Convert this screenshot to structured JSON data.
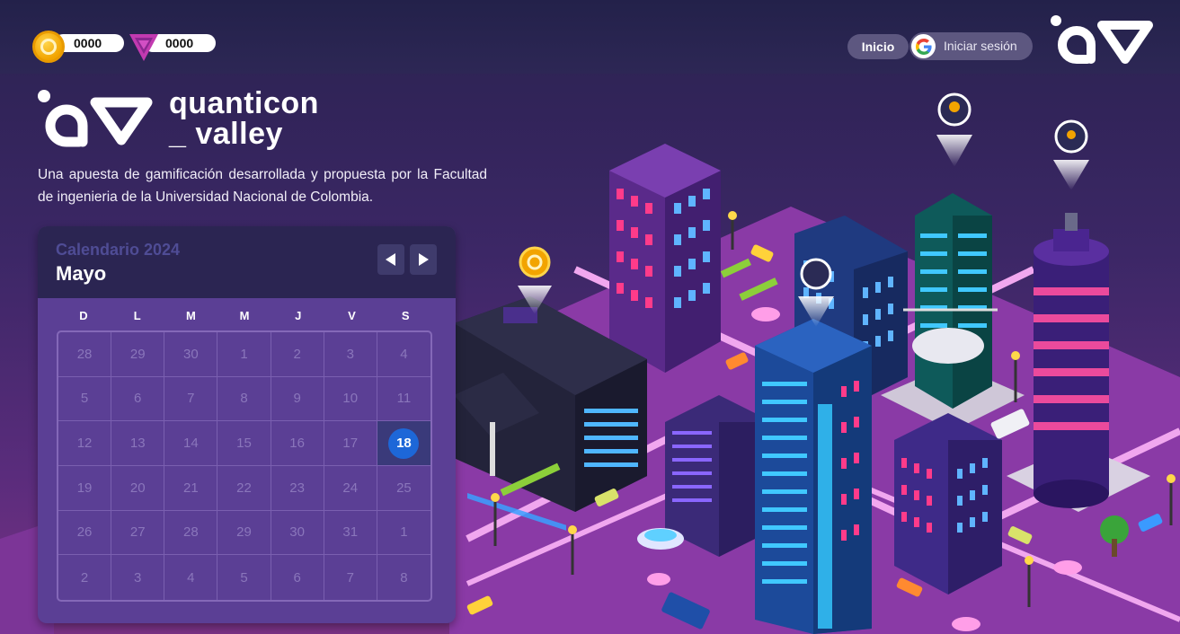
{
  "topbar": {
    "coins": "0000",
    "gems": "0000",
    "nav_home": "Inicio",
    "login_label": "Iniciar sesión"
  },
  "hero": {
    "brand_line1": "quanticon",
    "brand_line2": "_ valley",
    "description": "Una apuesta de gamificación desarrollada y propuesta por la Facultad de ingenieria de la Universidad Nacional de Colombia."
  },
  "calendar": {
    "year_label": "Calendario 2024",
    "month_label": "Mayo",
    "weekdays": [
      "D",
      "L",
      "M",
      "M",
      "J",
      "V",
      "S"
    ],
    "weeks": [
      [
        "28",
        "29",
        "30",
        "1",
        "2",
        "3",
        "4"
      ],
      [
        "5",
        "6",
        "7",
        "8",
        "9",
        "10",
        "11"
      ],
      [
        "12",
        "13",
        "14",
        "15",
        "16",
        "17",
        "18"
      ],
      [
        "19",
        "20",
        "21",
        "22",
        "23",
        "24",
        "25"
      ],
      [
        "26",
        "27",
        "28",
        "29",
        "30",
        "31",
        "1"
      ],
      [
        "2",
        "3",
        "4",
        "5",
        "6",
        "7",
        "8"
      ]
    ],
    "today": "18"
  },
  "colors": {
    "accent_blue": "#1d67d8",
    "coin_gold": "#f2a400",
    "gem_pink": "#c23ab0",
    "road_pink": "#e48fe0"
  },
  "icons": [
    "coin-icon",
    "gem-icon",
    "google-icon",
    "chevron-left-icon",
    "chevron-right-icon"
  ]
}
